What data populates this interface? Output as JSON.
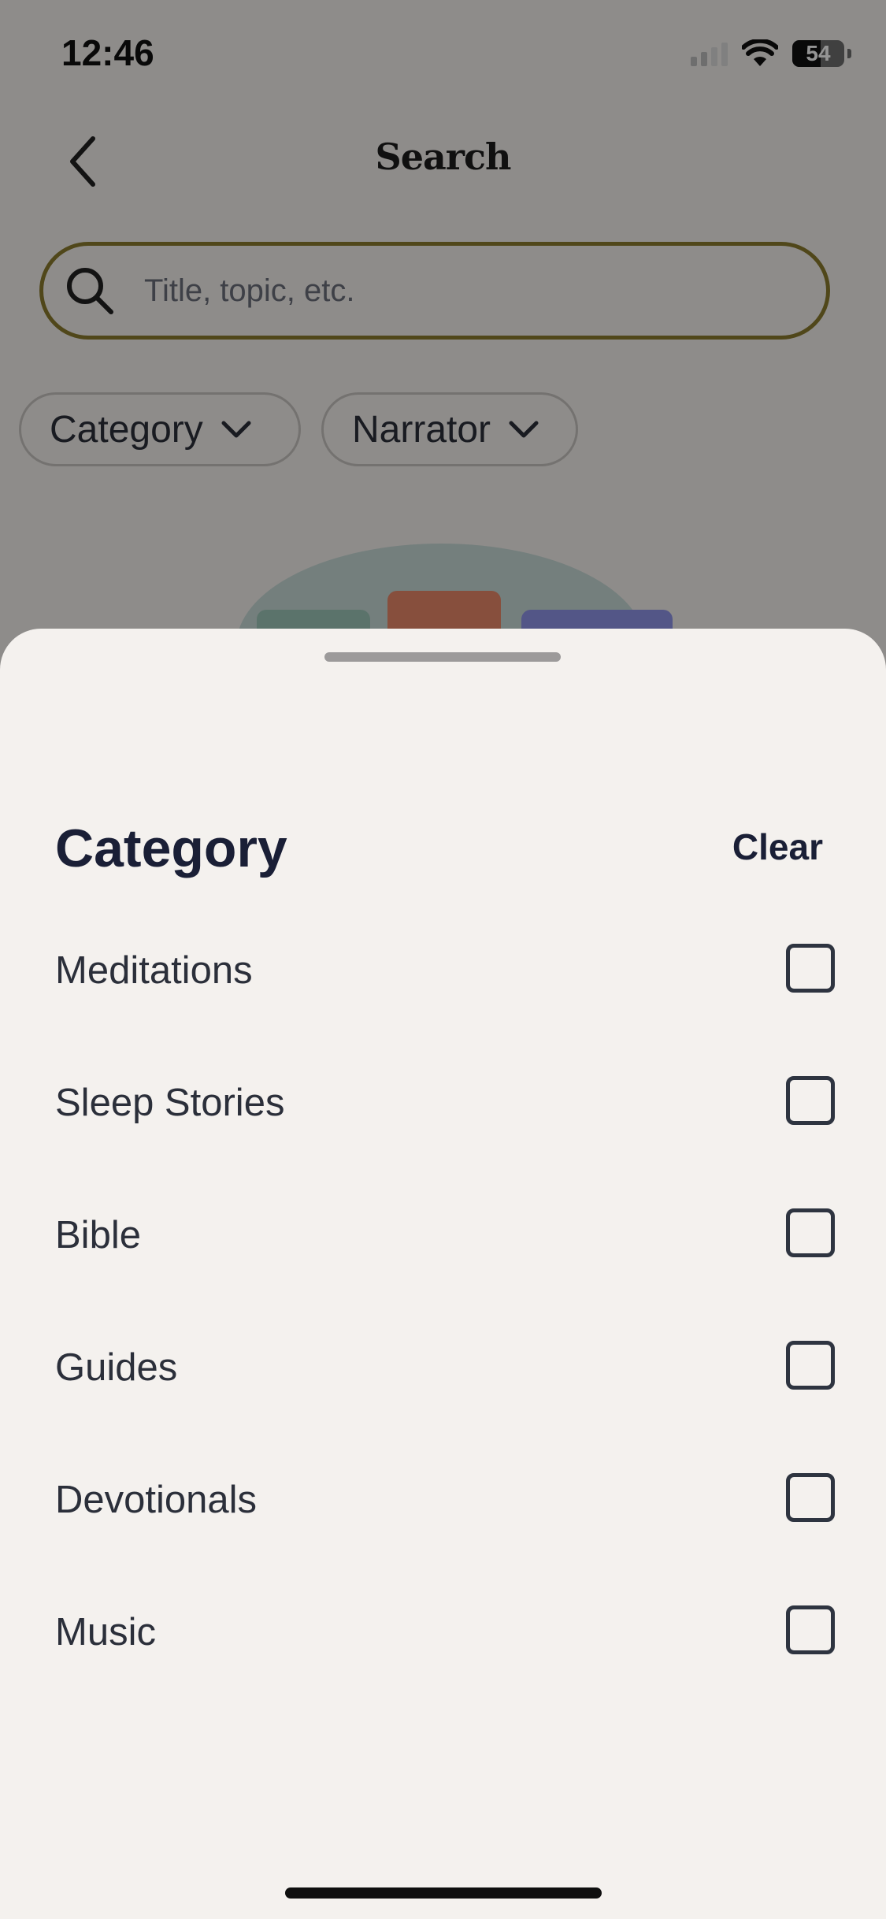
{
  "status_bar": {
    "time": "12:46",
    "battery_percent": "54"
  },
  "header": {
    "title": "Search"
  },
  "search": {
    "placeholder": "Title, topic, etc."
  },
  "filters": [
    {
      "label": "Category"
    },
    {
      "label": "Narrator"
    }
  ],
  "sheet": {
    "title": "Category",
    "clear_label": "Clear",
    "options": [
      {
        "label": "Meditations",
        "checked": false
      },
      {
        "label": "Sleep Stories",
        "checked": false
      },
      {
        "label": "Bible",
        "checked": false
      },
      {
        "label": "Guides",
        "checked": false
      },
      {
        "label": "Devotionals",
        "checked": false
      },
      {
        "label": "Music",
        "checked": false
      }
    ]
  },
  "colors": {
    "search_border": "#8a7a2e",
    "sheet_background": "#f4f1ee",
    "title_text": "#1a1f36"
  }
}
